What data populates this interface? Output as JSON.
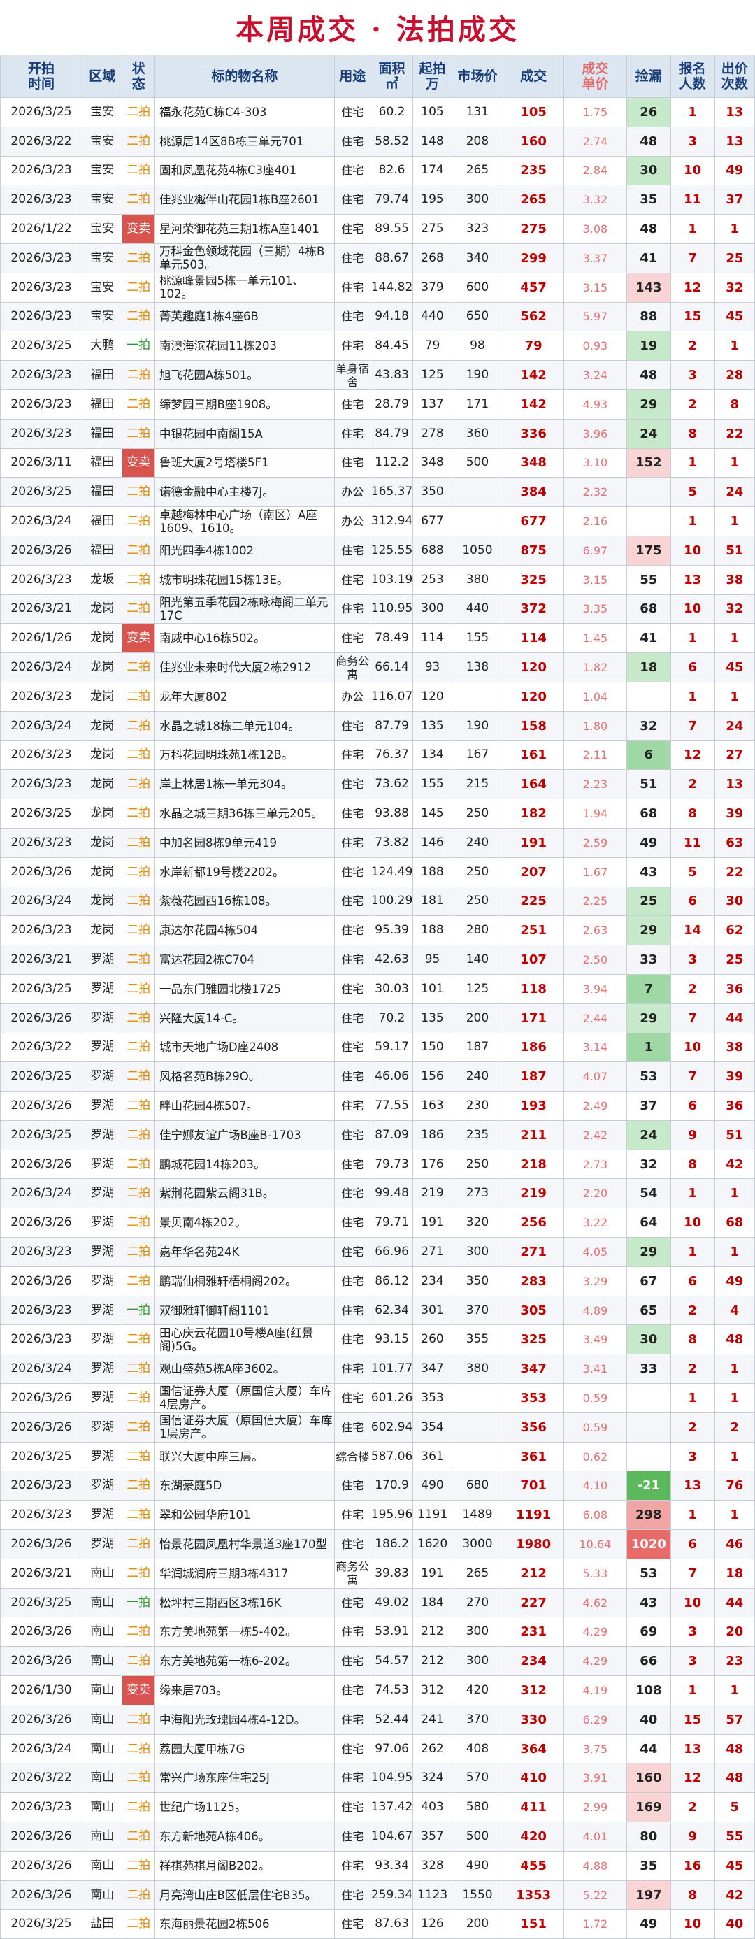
{
  "title": "本周成交 · 法拍成交",
  "headers": {
    "date": "开拍\n时间",
    "district": "区域",
    "status": "状\n态",
    "name": "标的物名称",
    "use": "用途",
    "area": "面积\n㎡",
    "start": "起拍\n万",
    "market": "市场价",
    "deal": "成交",
    "unit_price": "成交\n单价",
    "leak": "捡漏",
    "registrants": "报名\n人数",
    "bids": "出价\n次数"
  },
  "rows": [
    [
      "2026/3/25",
      "宝安",
      "二拍",
      "福永花苑C栋C4-303",
      "住宅",
      "60.2",
      "105",
      "131",
      "105",
      "1.75",
      "26",
      "1",
      "13"
    ],
    [
      "2026/3/22",
      "宝安",
      "二拍",
      "桃源居14区8B栋三单元701",
      "住宅",
      "58.52",
      "148",
      "208",
      "160",
      "2.74",
      "48",
      "3",
      "13"
    ],
    [
      "2026/3/23",
      "宝安",
      "二拍",
      "固和凤凰花苑4栋C3座401",
      "住宅",
      "82.6",
      "174",
      "265",
      "235",
      "2.84",
      "30",
      "10",
      "49"
    ],
    [
      "2026/3/23",
      "宝安",
      "二拍",
      "佳兆业樾伴山花园1栋B座2601",
      "住宅",
      "79.74",
      "195",
      "300",
      "265",
      "3.32",
      "35",
      "11",
      "37"
    ],
    [
      "2026/1/22",
      "宝安",
      "变卖",
      "星河荣御花苑三期1栋A座1401",
      "住宅",
      "89.55",
      "275",
      "323",
      "275",
      "3.08",
      "48",
      "1",
      "1"
    ],
    [
      "2026/3/23",
      "宝安",
      "二拍",
      "万科金色领域花园（三期）4栋B单元503。",
      "住宅",
      "88.67",
      "268",
      "340",
      "299",
      "3.37",
      "41",
      "7",
      "25"
    ],
    [
      "2026/3/23",
      "宝安",
      "二拍",
      "桃源峰景园5栋一单元101、102。",
      "住宅",
      "144.82",
      "379",
      "600",
      "457",
      "3.15",
      "143",
      "12",
      "32"
    ],
    [
      "2026/3/23",
      "宝安",
      "二拍",
      "菁英趣庭1栋4座6B",
      "住宅",
      "94.18",
      "440",
      "650",
      "562",
      "5.97",
      "88",
      "15",
      "45"
    ],
    [
      "2026/3/25",
      "大鹏",
      "一拍",
      "南澳海滨花园11栋203",
      "住宅",
      "84.45",
      "79",
      "98",
      "79",
      "0.93",
      "19",
      "2",
      "1"
    ],
    [
      "2026/3/23",
      "福田",
      "二拍",
      "旭飞花园A栋501。",
      "单身宿舍",
      "43.83",
      "125",
      "190",
      "142",
      "3.24",
      "48",
      "3",
      "28"
    ],
    [
      "2026/3/23",
      "福田",
      "二拍",
      "缔梦园三期B座1908。",
      "住宅",
      "28.79",
      "137",
      "171",
      "142",
      "4.93",
      "29",
      "2",
      "8"
    ],
    [
      "2026/3/23",
      "福田",
      "二拍",
      "中银花园中南阁15A",
      "住宅",
      "84.79",
      "278",
      "360",
      "336",
      "3.96",
      "24",
      "8",
      "22"
    ],
    [
      "2026/3/11",
      "福田",
      "变卖",
      "鲁班大厦2号塔楼5F1",
      "住宅",
      "112.2",
      "348",
      "500",
      "348",
      "3.10",
      "152",
      "1",
      "1"
    ],
    [
      "2026/3/25",
      "福田",
      "二拍",
      "诺德金融中心主楼7J。",
      "办公",
      "165.37",
      "350",
      "",
      "384",
      "2.32",
      "",
      "5",
      "24"
    ],
    [
      "2026/3/24",
      "福田",
      "二拍",
      "卓越梅林中心广场（南区）A座1609、1610。",
      "办公",
      "312.94",
      "677",
      "",
      "677",
      "2.16",
      "",
      "1",
      "1"
    ],
    [
      "2026/3/26",
      "福田",
      "二拍",
      "阳光四季4栋1002",
      "住宅",
      "125.55",
      "688",
      "1050",
      "875",
      "6.97",
      "175",
      "10",
      "51"
    ],
    [
      "2026/3/23",
      "龙坂",
      "二拍",
      "城市明珠花园15栋13E。",
      "住宅",
      "103.19",
      "253",
      "380",
      "325",
      "3.15",
      "55",
      "13",
      "38"
    ],
    [
      "2026/3/21",
      "龙岗",
      "二拍",
      "阳光第五季花园2栋咏梅阁二单元17C",
      "住宅",
      "110.95",
      "300",
      "440",
      "372",
      "3.35",
      "68",
      "10",
      "32"
    ],
    [
      "2026/1/26",
      "龙岗",
      "变卖",
      "南威中心16栋502。",
      "住宅",
      "78.49",
      "114",
      "155",
      "114",
      "1.45",
      "41",
      "1",
      "1"
    ],
    [
      "2026/3/24",
      "龙岗",
      "二拍",
      "佳兆业未来时代大厦2栋2912",
      "商务公寓",
      "66.14",
      "93",
      "138",
      "120",
      "1.82",
      "18",
      "6",
      "45"
    ],
    [
      "2026/3/23",
      "龙岗",
      "二拍",
      "龙年大厦802",
      "办公",
      "116.07",
      "120",
      "",
      "120",
      "1.04",
      "",
      "1",
      "1"
    ],
    [
      "2026/3/24",
      "龙岗",
      "二拍",
      "水晶之城18栋二单元104。",
      "住宅",
      "87.79",
      "135",
      "190",
      "158",
      "1.80",
      "32",
      "7",
      "24"
    ],
    [
      "2026/3/23",
      "龙岗",
      "二拍",
      "万科花园明珠苑1栋12B。",
      "住宅",
      "76.37",
      "134",
      "167",
      "161",
      "2.11",
      "6",
      "12",
      "27"
    ],
    [
      "2026/3/23",
      "龙岗",
      "二拍",
      "岸上林居1栋一单元304。",
      "住宅",
      "73.62",
      "155",
      "215",
      "164",
      "2.23",
      "51",
      "2",
      "13"
    ],
    [
      "2026/3/25",
      "龙岗",
      "二拍",
      "水晶之城三期36栋三单元205。",
      "住宅",
      "93.88",
      "145",
      "250",
      "182",
      "1.94",
      "68",
      "8",
      "39"
    ],
    [
      "2026/3/23",
      "龙岗",
      "二拍",
      "中加名园8栋9单元419",
      "住宅",
      "73.82",
      "146",
      "240",
      "191",
      "2.59",
      "49",
      "11",
      "63"
    ],
    [
      "2026/3/26",
      "龙岗",
      "二拍",
      "水岸新都19号楼2202。",
      "住宅",
      "124.49",
      "188",
      "250",
      "207",
      "1.67",
      "43",
      "5",
      "22"
    ],
    [
      "2026/3/24",
      "龙岗",
      "二拍",
      "紫薇花园西16栋108。",
      "住宅",
      "100.29",
      "181",
      "250",
      "225",
      "2.25",
      "25",
      "6",
      "30"
    ],
    [
      "2026/3/23",
      "龙岗",
      "二拍",
      "康达尔花园4栋504",
      "住宅",
      "95.39",
      "188",
      "280",
      "251",
      "2.63",
      "29",
      "14",
      "62"
    ],
    [
      "2026/3/21",
      "罗湖",
      "二拍",
      "富达花园2栋C704",
      "住宅",
      "42.63",
      "95",
      "140",
      "107",
      "2.50",
      "33",
      "3",
      "25"
    ],
    [
      "2026/3/25",
      "罗湖",
      "二拍",
      "一品东门雅园北楼1725",
      "住宅",
      "30.03",
      "101",
      "125",
      "118",
      "3.94",
      "7",
      "2",
      "36"
    ],
    [
      "2026/3/26",
      "罗湖",
      "二拍",
      "兴隆大厦14-C。",
      "住宅",
      "70.2",
      "135",
      "200",
      "171",
      "2.44",
      "29",
      "7",
      "44"
    ],
    [
      "2026/3/22",
      "罗湖",
      "二拍",
      "城市天地广场D座2408",
      "住宅",
      "59.17",
      "150",
      "187",
      "186",
      "3.14",
      "1",
      "10",
      "38"
    ],
    [
      "2026/3/25",
      "罗湖",
      "二拍",
      "风格名苑B栋29O。",
      "住宅",
      "46.06",
      "156",
      "240",
      "187",
      "4.07",
      "53",
      "7",
      "39"
    ],
    [
      "2026/3/26",
      "罗湖",
      "二拍",
      "畔山花园4栋507。",
      "住宅",
      "77.55",
      "163",
      "230",
      "193",
      "2.49",
      "37",
      "6",
      "36"
    ],
    [
      "2026/3/25",
      "罗湖",
      "二拍",
      "佳宁娜友谊广场B座B-1703",
      "住宅",
      "87.09",
      "186",
      "235",
      "211",
      "2.42",
      "24",
      "9",
      "51"
    ],
    [
      "2026/3/26",
      "罗湖",
      "二拍",
      "鹏城花园14栋203。",
      "住宅",
      "79.73",
      "176",
      "250",
      "218",
      "2.73",
      "32",
      "8",
      "42"
    ],
    [
      "2026/3/24",
      "罗湖",
      "二拍",
      "紫荆花园紫云阁31B。",
      "住宅",
      "99.48",
      "219",
      "273",
      "219",
      "2.20",
      "54",
      "1",
      "1"
    ],
    [
      "2026/3/26",
      "罗湖",
      "二拍",
      "景贝南4栋202。",
      "住宅",
      "79.71",
      "191",
      "320",
      "256",
      "3.22",
      "64",
      "10",
      "68"
    ],
    [
      "2026/3/23",
      "罗湖",
      "二拍",
      "嘉年华名苑24K",
      "住宅",
      "66.96",
      "271",
      "300",
      "271",
      "4.05",
      "29",
      "1",
      "1"
    ],
    [
      "2026/3/26",
      "罗湖",
      "二拍",
      "鹏瑞仙桐雅轩梧桐阁202。",
      "住宅",
      "86.12",
      "234",
      "350",
      "283",
      "3.29",
      "67",
      "6",
      "49"
    ],
    [
      "2026/3/23",
      "罗湖",
      "一拍",
      "双御雅轩御轩阁1101",
      "住宅",
      "62.34",
      "301",
      "370",
      "305",
      "4.89",
      "65",
      "2",
      "4"
    ],
    [
      "2026/3/23",
      "罗湖",
      "二拍",
      "田心庆云花园10号楼A座(红景阁)5G。",
      "住宅",
      "93.15",
      "260",
      "355",
      "325",
      "3.49",
      "30",
      "8",
      "48"
    ],
    [
      "2026/3/24",
      "罗湖",
      "二拍",
      "观山盛苑5栋A座3602。",
      "住宅",
      "101.77",
      "347",
      "380",
      "347",
      "3.41",
      "33",
      "2",
      "1"
    ],
    [
      "2026/3/26",
      "罗湖",
      "二拍",
      "国信证券大厦（原国信大厦）车库4层房产。",
      "住宅",
      "601.26",
      "353",
      "",
      "353",
      "0.59",
      "",
      "1",
      "1"
    ],
    [
      "2026/3/26",
      "罗湖",
      "二拍",
      "国信证券大厦（原国信大厦）车库1层房产。",
      "住宅",
      "602.94",
      "354",
      "",
      "356",
      "0.59",
      "",
      "2",
      "2"
    ],
    [
      "2026/3/25",
      "罗湖",
      "二拍",
      "联兴大厦中座三层。",
      "综合楼",
      "587.06",
      "361",
      "",
      "361",
      "0.62",
      "",
      "3",
      "1"
    ],
    [
      "2026/3/23",
      "罗湖",
      "二拍",
      "东湖豪庭5D",
      "住宅",
      "170.9",
      "490",
      "680",
      "701",
      "4.10",
      "-21",
      "13",
      "76"
    ],
    [
      "2026/3/23",
      "罗湖",
      "二拍",
      "翠和公园华府101",
      "住宅",
      "195.96",
      "1191",
      "1489",
      "1191",
      "6.08",
      "298",
      "1",
      "1"
    ],
    [
      "2026/3/26",
      "罗湖",
      "二拍",
      "怡景花园凤凰村华景道3座170型",
      "住宅",
      "186.2",
      "1620",
      "3000",
      "1980",
      "10.64",
      "1020",
      "6",
      "46"
    ],
    [
      "2026/3/21",
      "南山",
      "二拍",
      "华润城润府三期3栋4317",
      "商务公寓",
      "39.83",
      "191",
      "265",
      "212",
      "5.33",
      "53",
      "7",
      "18"
    ],
    [
      "2026/3/25",
      "南山",
      "一拍",
      "松坪村三期西区3栋16K",
      "住宅",
      "49.02",
      "184",
      "270",
      "227",
      "4.62",
      "43",
      "10",
      "44"
    ],
    [
      "2026/3/26",
      "南山",
      "二拍",
      "东方美地苑第一栋5-402。",
      "住宅",
      "53.91",
      "212",
      "300",
      "231",
      "4.29",
      "69",
      "3",
      "20"
    ],
    [
      "2026/3/26",
      "南山",
      "二拍",
      "东方美地苑第一栋6-202。",
      "住宅",
      "54.57",
      "212",
      "300",
      "234",
      "4.29",
      "66",
      "3",
      "23"
    ],
    [
      "2026/1/30",
      "南山",
      "变卖",
      "缘来居703。",
      "住宅",
      "74.53",
      "312",
      "420",
      "312",
      "4.19",
      "108",
      "1",
      "1"
    ],
    [
      "2026/3/26",
      "南山",
      "二拍",
      "中海阳光玫瑰园4栋4-12D。",
      "住宅",
      "52.44",
      "241",
      "370",
      "330",
      "6.29",
      "40",
      "15",
      "57"
    ],
    [
      "2026/3/24",
      "南山",
      "二拍",
      "荔园大厦甲栋7G",
      "住宅",
      "97.06",
      "262",
      "408",
      "364",
      "3.75",
      "44",
      "13",
      "48"
    ],
    [
      "2026/3/22",
      "南山",
      "二拍",
      "常兴广场东座住宅25J",
      "住宅",
      "104.95",
      "324",
      "570",
      "410",
      "3.91",
      "160",
      "12",
      "48"
    ],
    [
      "2026/3/23",
      "南山",
      "二拍",
      "世纪广场1125。",
      "住宅",
      "137.42",
      "403",
      "580",
      "411",
      "2.99",
      "169",
      "2",
      "5"
    ],
    [
      "2026/3/26",
      "南山",
      "二拍",
      "东方新地苑A栋406。",
      "住宅",
      "104.67",
      "357",
      "500",
      "420",
      "4.01",
      "80",
      "9",
      "55"
    ],
    [
      "2026/3/26",
      "南山",
      "二拍",
      "祥祺苑祺月阁B202。",
      "住宅",
      "93.34",
      "328",
      "490",
      "455",
      "4.88",
      "35",
      "16",
      "45"
    ],
    [
      "2026/3/26",
      "南山",
      "二拍",
      "月亮湾山庄B区低层住宅B35。",
      "住宅",
      "259.34",
      "1123",
      "1550",
      "1353",
      "5.22",
      "197",
      "8",
      "42"
    ],
    [
      "2026/3/25",
      "盐田",
      "二拍",
      "东海丽景花园2栋506",
      "住宅",
      "87.63",
      "126",
      "200",
      "151",
      "1.72",
      "49",
      "10",
      "40"
    ]
  ]
}
